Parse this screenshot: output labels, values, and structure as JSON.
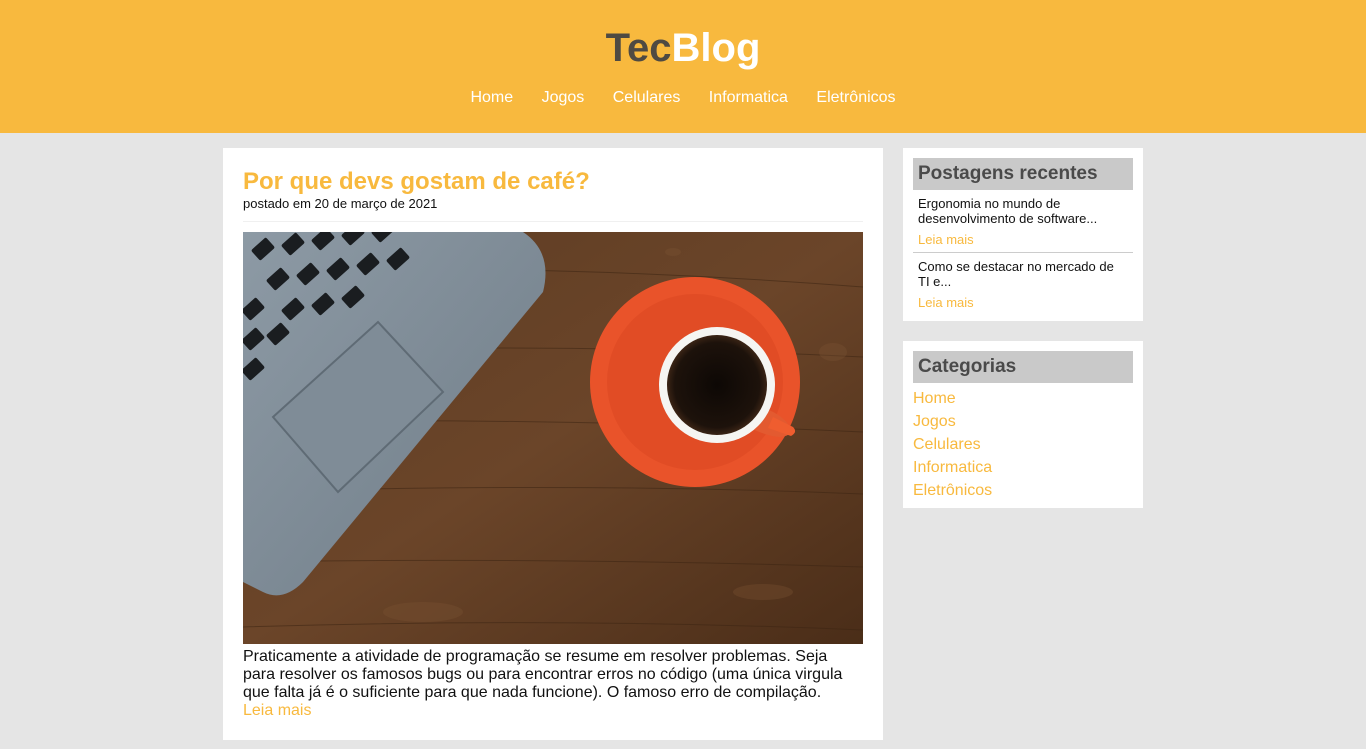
{
  "site": {
    "logo_part1": "Tec",
    "logo_part2": "Blog",
    "nav": [
      "Home",
      "Jogos",
      "Celulares",
      "Informatica",
      "Eletrônicos"
    ]
  },
  "colors": {
    "accent": "#f8b93e",
    "background": "#e5e5e5",
    "header_title_dark": "#4f4a42"
  },
  "post": {
    "title": "Por que devs gostam de café?",
    "meta": "postado em 20 de março de 2021",
    "image_icon": "laptop-coffee-photo",
    "excerpt": "Praticamente a atividade de programação se resume em resolver problemas. Seja para resolver os famosos bugs ou para encontrar erros no código (uma única virgula que falta já é o suficiente para que nada funcione). O famoso erro de compilação.",
    "read_more": "Leia mais"
  },
  "sidebar": {
    "recent": {
      "title": "Postagens recentes",
      "items": [
        {
          "text": "Ergonomia no mundo de desenvolvimento de software...",
          "link": "Leia mais"
        },
        {
          "text": "Como se destacar no mercado de TI e...",
          "link": "Leia mais"
        }
      ]
    },
    "categories": {
      "title": "Categorias",
      "items": [
        "Home",
        "Jogos",
        "Celulares",
        "Informatica",
        "Eletrônicos"
      ]
    }
  }
}
